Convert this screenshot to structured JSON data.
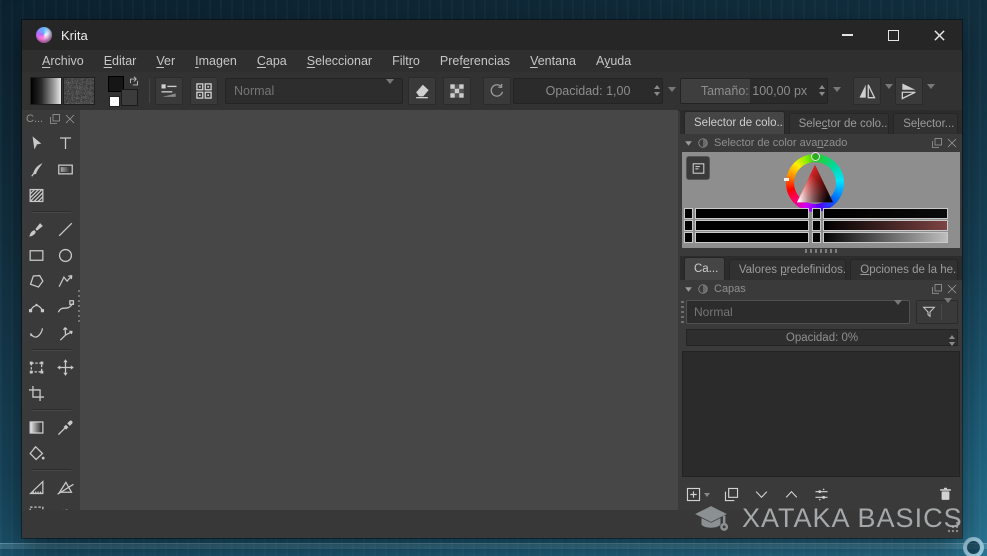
{
  "window": {
    "title": "Krita",
    "controls": [
      {
        "name": "minimize"
      },
      {
        "name": "maximize"
      },
      {
        "name": "close"
      }
    ]
  },
  "menu": {
    "items": [
      {
        "label": "Archivo",
        "mnemonic": 0
      },
      {
        "label": "Editar",
        "mnemonic": 0
      },
      {
        "label": "Ver",
        "mnemonic": 0
      },
      {
        "label": "Imagen",
        "mnemonic": 0
      },
      {
        "label": "Capa",
        "mnemonic": 0
      },
      {
        "label": "Seleccionar",
        "mnemonic": 0
      },
      {
        "label": "Filtro",
        "mnemonic": 4
      },
      {
        "label": "Preferencias",
        "mnemonic": 4
      },
      {
        "label": "Ventana",
        "mnemonic": 0
      },
      {
        "label": "Ayuda",
        "mnemonic": 1
      }
    ]
  },
  "toolbar": {
    "gradient_swatch": "gradient-swatch",
    "pattern_swatch": "pattern-swatch",
    "fgbg": {
      "foreground": "#161616",
      "background": "#3c3c3c",
      "reset_small": "#ffffff"
    },
    "blend_mode": {
      "value": "Normal"
    },
    "opacity": {
      "label": "Opacidad:",
      "value": "1,00"
    },
    "size": {
      "label": "Tamaño:",
      "value": "100,00 px",
      "fill_ratio": 0.47
    },
    "buttons": [
      "brush-option-slider",
      "brush-presets",
      "eraser-mode",
      "preserve-alpha",
      "reload-preset",
      "mirror-horizontal",
      "mirror-vertical"
    ]
  },
  "toolbox": {
    "header": "C...",
    "tools": [
      "select-shapes",
      "text",
      "calligraphy",
      "container",
      "pattern-edit",
      null,
      "sep",
      "freehand-brush",
      "line",
      "rectangle",
      "ellipse",
      "polygon",
      "polyline",
      "bezier-curve",
      "freehand-path",
      "dynamic-brush",
      "multibrush",
      "sep",
      "transform",
      "move",
      "crop",
      null,
      "sep",
      "gradient",
      "color-sampler",
      "fill",
      null,
      "sep",
      "measure",
      "assistants",
      "rect-select",
      "outline-select"
    ]
  },
  "color_docker": {
    "tabs": [
      {
        "label": "Selector de colo...",
        "active": true,
        "mnemonic": -1
      },
      {
        "label": "Selector de colo...",
        "active": false,
        "mnemonic": 4
      },
      {
        "label": "Selector...",
        "active": false,
        "mnemonic": 2
      }
    ],
    "title": "Selector de color avanzado",
    "title_mnemonic": 21,
    "sliders": {
      "left": [
        {
          "from": "#000000",
          "to": "#000000"
        },
        {
          "from": "#000000",
          "to": "#000000"
        },
        {
          "from": "#000000",
          "to": "#000000"
        }
      ],
      "right": [
        {
          "from": "#000000",
          "to": "#0a0a0a"
        },
        {
          "from": "#000000",
          "to": "#7d4343"
        },
        {
          "from": "#050505",
          "to": "#bdbdbd"
        }
      ]
    }
  },
  "preset_tabs": [
    {
      "label": "Ca...",
      "active": true,
      "mnemonic": -1
    },
    {
      "label": "Valores predefinidos...",
      "active": false,
      "mnemonic": 8
    },
    {
      "label": "Opciones de la he...",
      "active": false,
      "mnemonic": 0
    }
  ],
  "layers": {
    "title": "Capas",
    "blend_mode": "Normal",
    "opacity": "Opacidad: 0%",
    "buttons": [
      {
        "name": "add-layer",
        "icon": "addlayer",
        "dropdown": true
      },
      {
        "name": "duplicate-layer",
        "icon": "duplicate",
        "dropdown": false
      },
      {
        "name": "move-layer-down",
        "icon": "chevdown",
        "dropdown": false
      },
      {
        "name": "move-layer-up",
        "icon": "chevup",
        "dropdown": false
      },
      {
        "name": "layer-properties",
        "icon": "props",
        "dropdown": false
      },
      {
        "name": "delete-layer",
        "icon": "trash",
        "dropdown": false
      }
    ]
  },
  "watermark": {
    "text": "XATAKA BASICS"
  },
  "colors": {
    "titlebar": "#262626",
    "menubar": "#2f2f2f",
    "toolbar": "#323232",
    "panel": "#3a3a3a",
    "canvas": "#474747",
    "selector_background": "#8e8e8e",
    "layer_list": "#2b2b2b",
    "desktop_top": "#0c2230",
    "desktop_bottom": "#2b7795",
    "slider_red": "#7d4343"
  }
}
